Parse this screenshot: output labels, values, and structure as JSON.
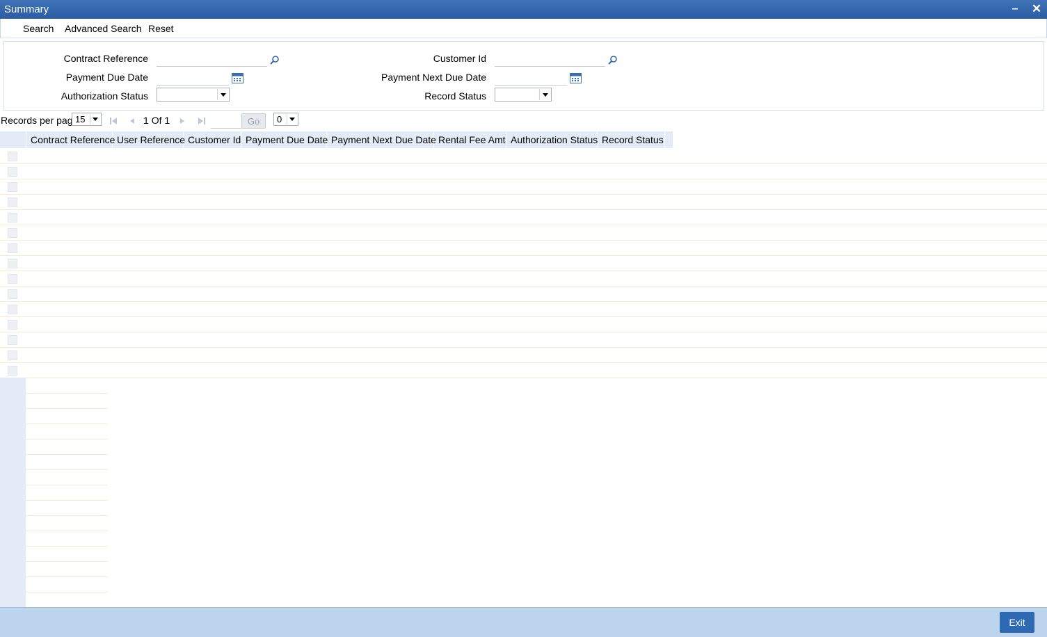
{
  "window": {
    "title": "Summary"
  },
  "toolbar": {
    "search": "Search",
    "advanced_search": "Advanced Search",
    "reset": "Reset"
  },
  "form": {
    "contract_reference_label": "Contract Reference",
    "payment_due_date_label": "Payment Due Date",
    "authorization_status_label": "Authorization Status",
    "customer_id_label": "Customer Id",
    "payment_next_due_date_label": "Payment Next Due Date",
    "record_status_label": "Record Status",
    "contract_reference_value": "",
    "payment_due_date_value": "",
    "authorization_status_value": "",
    "customer_id_value": "",
    "payment_next_due_date_value": "",
    "record_status_value": ""
  },
  "pager": {
    "records_per_page_label": "Records per page",
    "records_per_page_value": "15",
    "current_page": "1",
    "of_label": "Of",
    "total_pages": "1",
    "go_label": "Go",
    "page_select_value": "0",
    "page_input_value": ""
  },
  "grid": {
    "columns": [
      "Contract Reference",
      "User Reference",
      "Customer Id",
      "Payment Due Date",
      "Payment Next Due Date",
      "Rental Fee Amt",
      "Authorization Status",
      "Record Status"
    ],
    "rows": []
  },
  "footer": {
    "exit_label": "Exit"
  },
  "colors": {
    "title_bar": "#2a5da4",
    "header_bg": "#e2ebf6",
    "footer_bg": "#bcd4ec",
    "exit_button": "#2e69b1"
  }
}
